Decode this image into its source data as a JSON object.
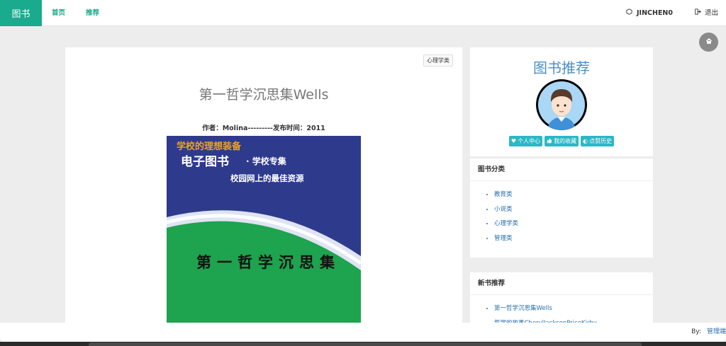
{
  "navbar": {
    "brand": "图书",
    "links": [
      "首页",
      "推荐"
    ],
    "username": "JINCHEN0",
    "logout": "退出"
  },
  "book": {
    "category_tag": "心理学类",
    "title": "第一哲学沉思集Wells",
    "meta": "作者：Molina---------发布时间：2011",
    "cover": {
      "line1": "学校的理想装备",
      "line2": "电子图书",
      "line2_suffix": "· 学校专集",
      "line3": "校园网上的最佳资源",
      "title": "第一哲学沉思集"
    }
  },
  "sidebar": {
    "title": "图书推荐",
    "buttons": [
      "个人中心",
      "我的收藏",
      "点赞历史"
    ],
    "categories": {
      "heading": "图书分类",
      "items": [
        "教育类",
        "小说类",
        "心理学类",
        "管理类"
      ]
    },
    "new_books": {
      "heading": "新书推荐",
      "items": [
        "第一哲学沉思集Wells",
        "哲学的故事CherylJacksonPriceKirby"
      ]
    }
  },
  "footer": {
    "by": "By:",
    "link": "管理端"
  },
  "colors": {
    "brand": "#1aaa8d",
    "accent_button": "#2bb8c4",
    "link": "#2a6fb0",
    "title_blue": "#4e8fc2"
  }
}
